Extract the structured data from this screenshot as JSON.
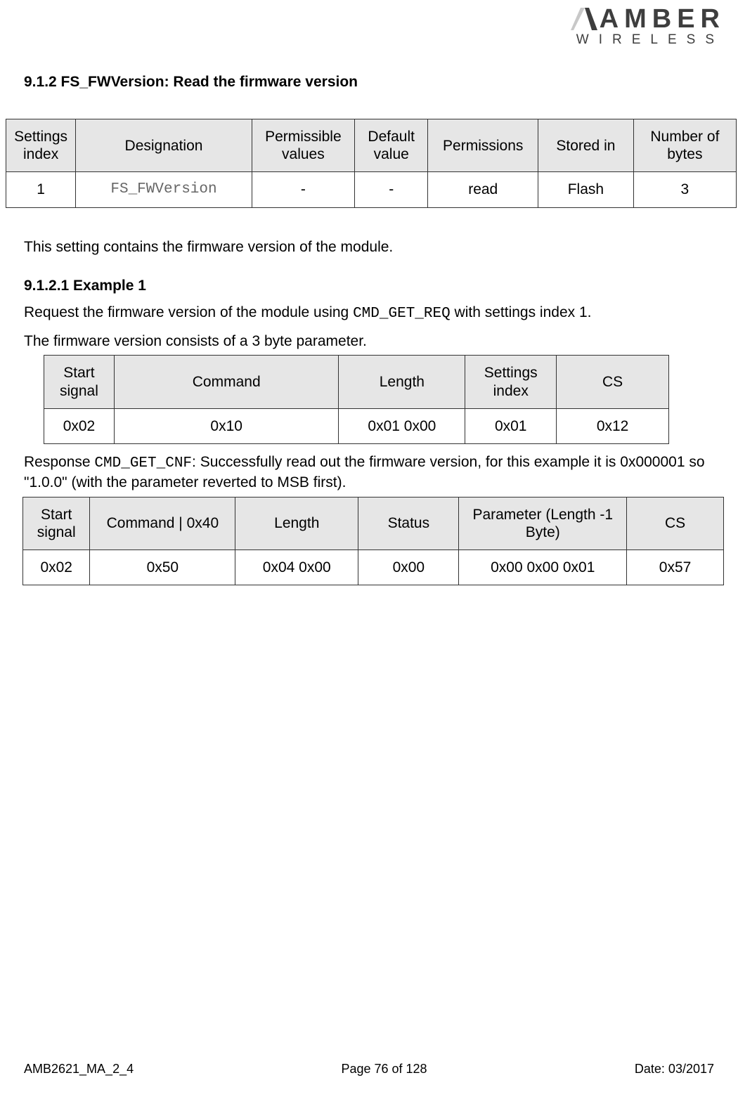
{
  "logo": {
    "line1": "AMBER",
    "line2": "WIRELESS"
  },
  "heading": "9.1.2 FS_FWVersion: Read the firmware version",
  "table1": {
    "headers": [
      "Settings index",
      "Designation",
      "Permissible values",
      "Default value",
      "Permissions",
      "Stored in",
      "Number of bytes"
    ],
    "row": {
      "c0": "1",
      "c1": "FS_FWVersion",
      "c2": "-",
      "c3": "-",
      "c4": "read",
      "c5": "Flash",
      "c6": "3"
    }
  },
  "para1": "This setting contains the firmware version of the module.",
  "subheading": "9.1.2.1    Example 1",
  "para2a": "Request the firmware version of the module using ",
  "para2b": " CMD_GET_REQ",
  "para2c": " with settings index 1.",
  "para3": "The firmware version consists of a 3 byte parameter.",
  "table2": {
    "headers": [
      "Start signal",
      "Command",
      "Length",
      "Settings index",
      "CS"
    ],
    "row": {
      "c0": "0x02",
      "c1": "0x10",
      "c2": "0x01 0x00",
      "c3": "0x01",
      "c4": "0x12"
    }
  },
  "para4a": "Response ",
  "para4b": "CMD_GET_CNF",
  "para4c": ": Successfully read out the firmware version, for this example it is 0x000001 so \"1.0.0\" (with the parameter reverted to MSB first).",
  "table3": {
    "headers": [
      "Start signal",
      "Command | 0x40",
      "Length",
      "Status",
      "Parameter (Length -1 Byte)",
      "CS"
    ],
    "row": {
      "c0": "0x02",
      "c1": "0x50",
      "c2": "0x04 0x00",
      "c3": "0x00",
      "c4": "0x00 0x00 0x01",
      "c5": "0x57"
    }
  },
  "footer": {
    "left": "AMB2621_MA_2_4",
    "center": "Page 76 of 128",
    "right": "Date: 03/2017"
  }
}
